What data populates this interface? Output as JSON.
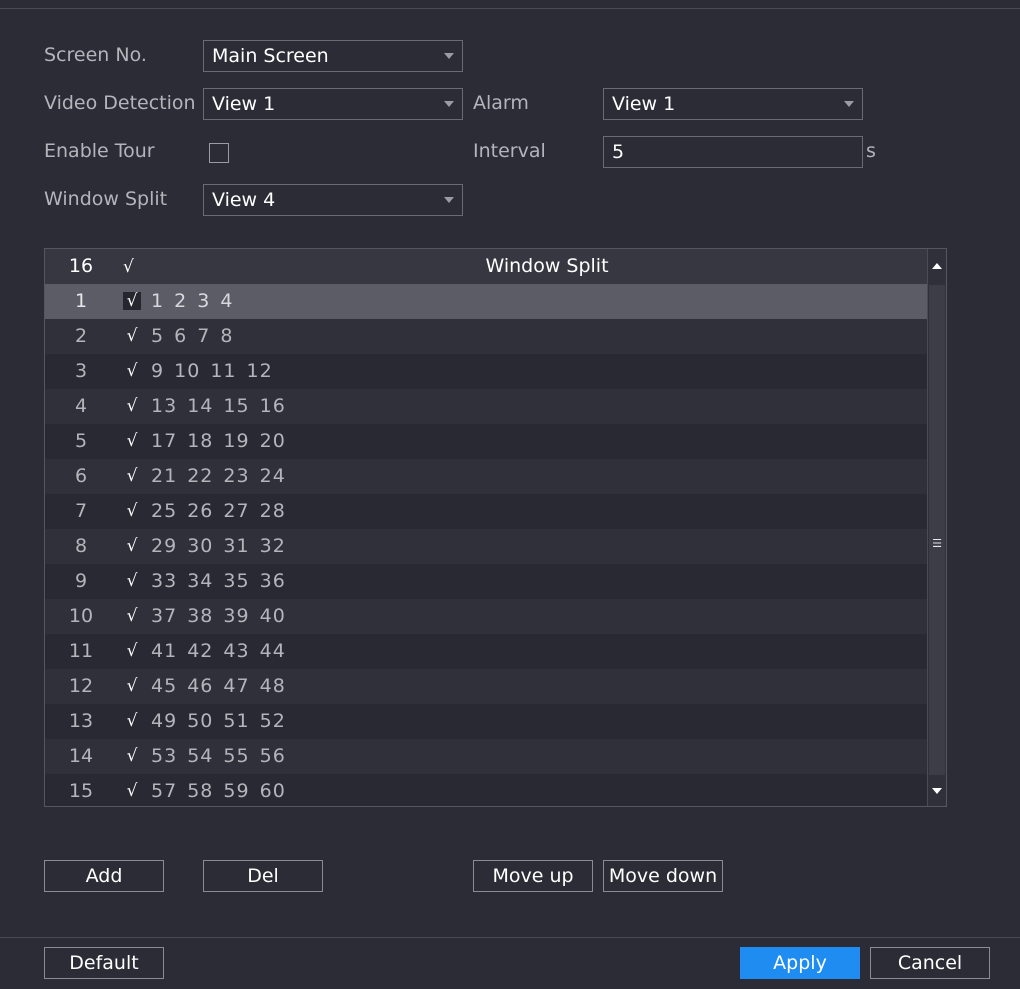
{
  "form": {
    "screen_no_label": "Screen No.",
    "screen_no_value": "Main Screen",
    "video_detection_label": "Video Detection",
    "video_detection_value": "View 1",
    "alarm_label": "Alarm",
    "alarm_value": "View 1",
    "enable_tour_label": "Enable Tour",
    "enable_tour_checked": false,
    "interval_label": "Interval",
    "interval_value": "5",
    "interval_unit": "s",
    "window_split_label": "Window Split",
    "window_split_value": "View 4"
  },
  "table": {
    "header_count": "16",
    "header_check": "√",
    "header_title": "Window Split",
    "check_glyph": "√",
    "selected_row": 0,
    "rows": [
      {
        "num": "1",
        "value": "1 2 3 4"
      },
      {
        "num": "2",
        "value": "5 6 7 8"
      },
      {
        "num": "3",
        "value": "9 10 11 12"
      },
      {
        "num": "4",
        "value": "13 14 15 16"
      },
      {
        "num": "5",
        "value": "17 18 19 20"
      },
      {
        "num": "6",
        "value": "21 22 23 24"
      },
      {
        "num": "7",
        "value": "25 26 27 28"
      },
      {
        "num": "8",
        "value": "29 30 31 32"
      },
      {
        "num": "9",
        "value": "33 34 35 36"
      },
      {
        "num": "10",
        "value": "37 38 39 40"
      },
      {
        "num": "11",
        "value": "41 42 43 44"
      },
      {
        "num": "12",
        "value": "45 46 47 48"
      },
      {
        "num": "13",
        "value": "49 50 51 52"
      },
      {
        "num": "14",
        "value": "53 54 55 56"
      },
      {
        "num": "15",
        "value": "57 58 59 60"
      }
    ]
  },
  "actions": {
    "add": "Add",
    "del": "Del",
    "move_up": "Move up",
    "move_down": "Move down"
  },
  "footer": {
    "default": "Default",
    "apply": "Apply",
    "cancel": "Cancel"
  },
  "colors": {
    "background": "#2b2c35",
    "accent": "#1e8cf0",
    "selected_row": "#5b5c66"
  }
}
